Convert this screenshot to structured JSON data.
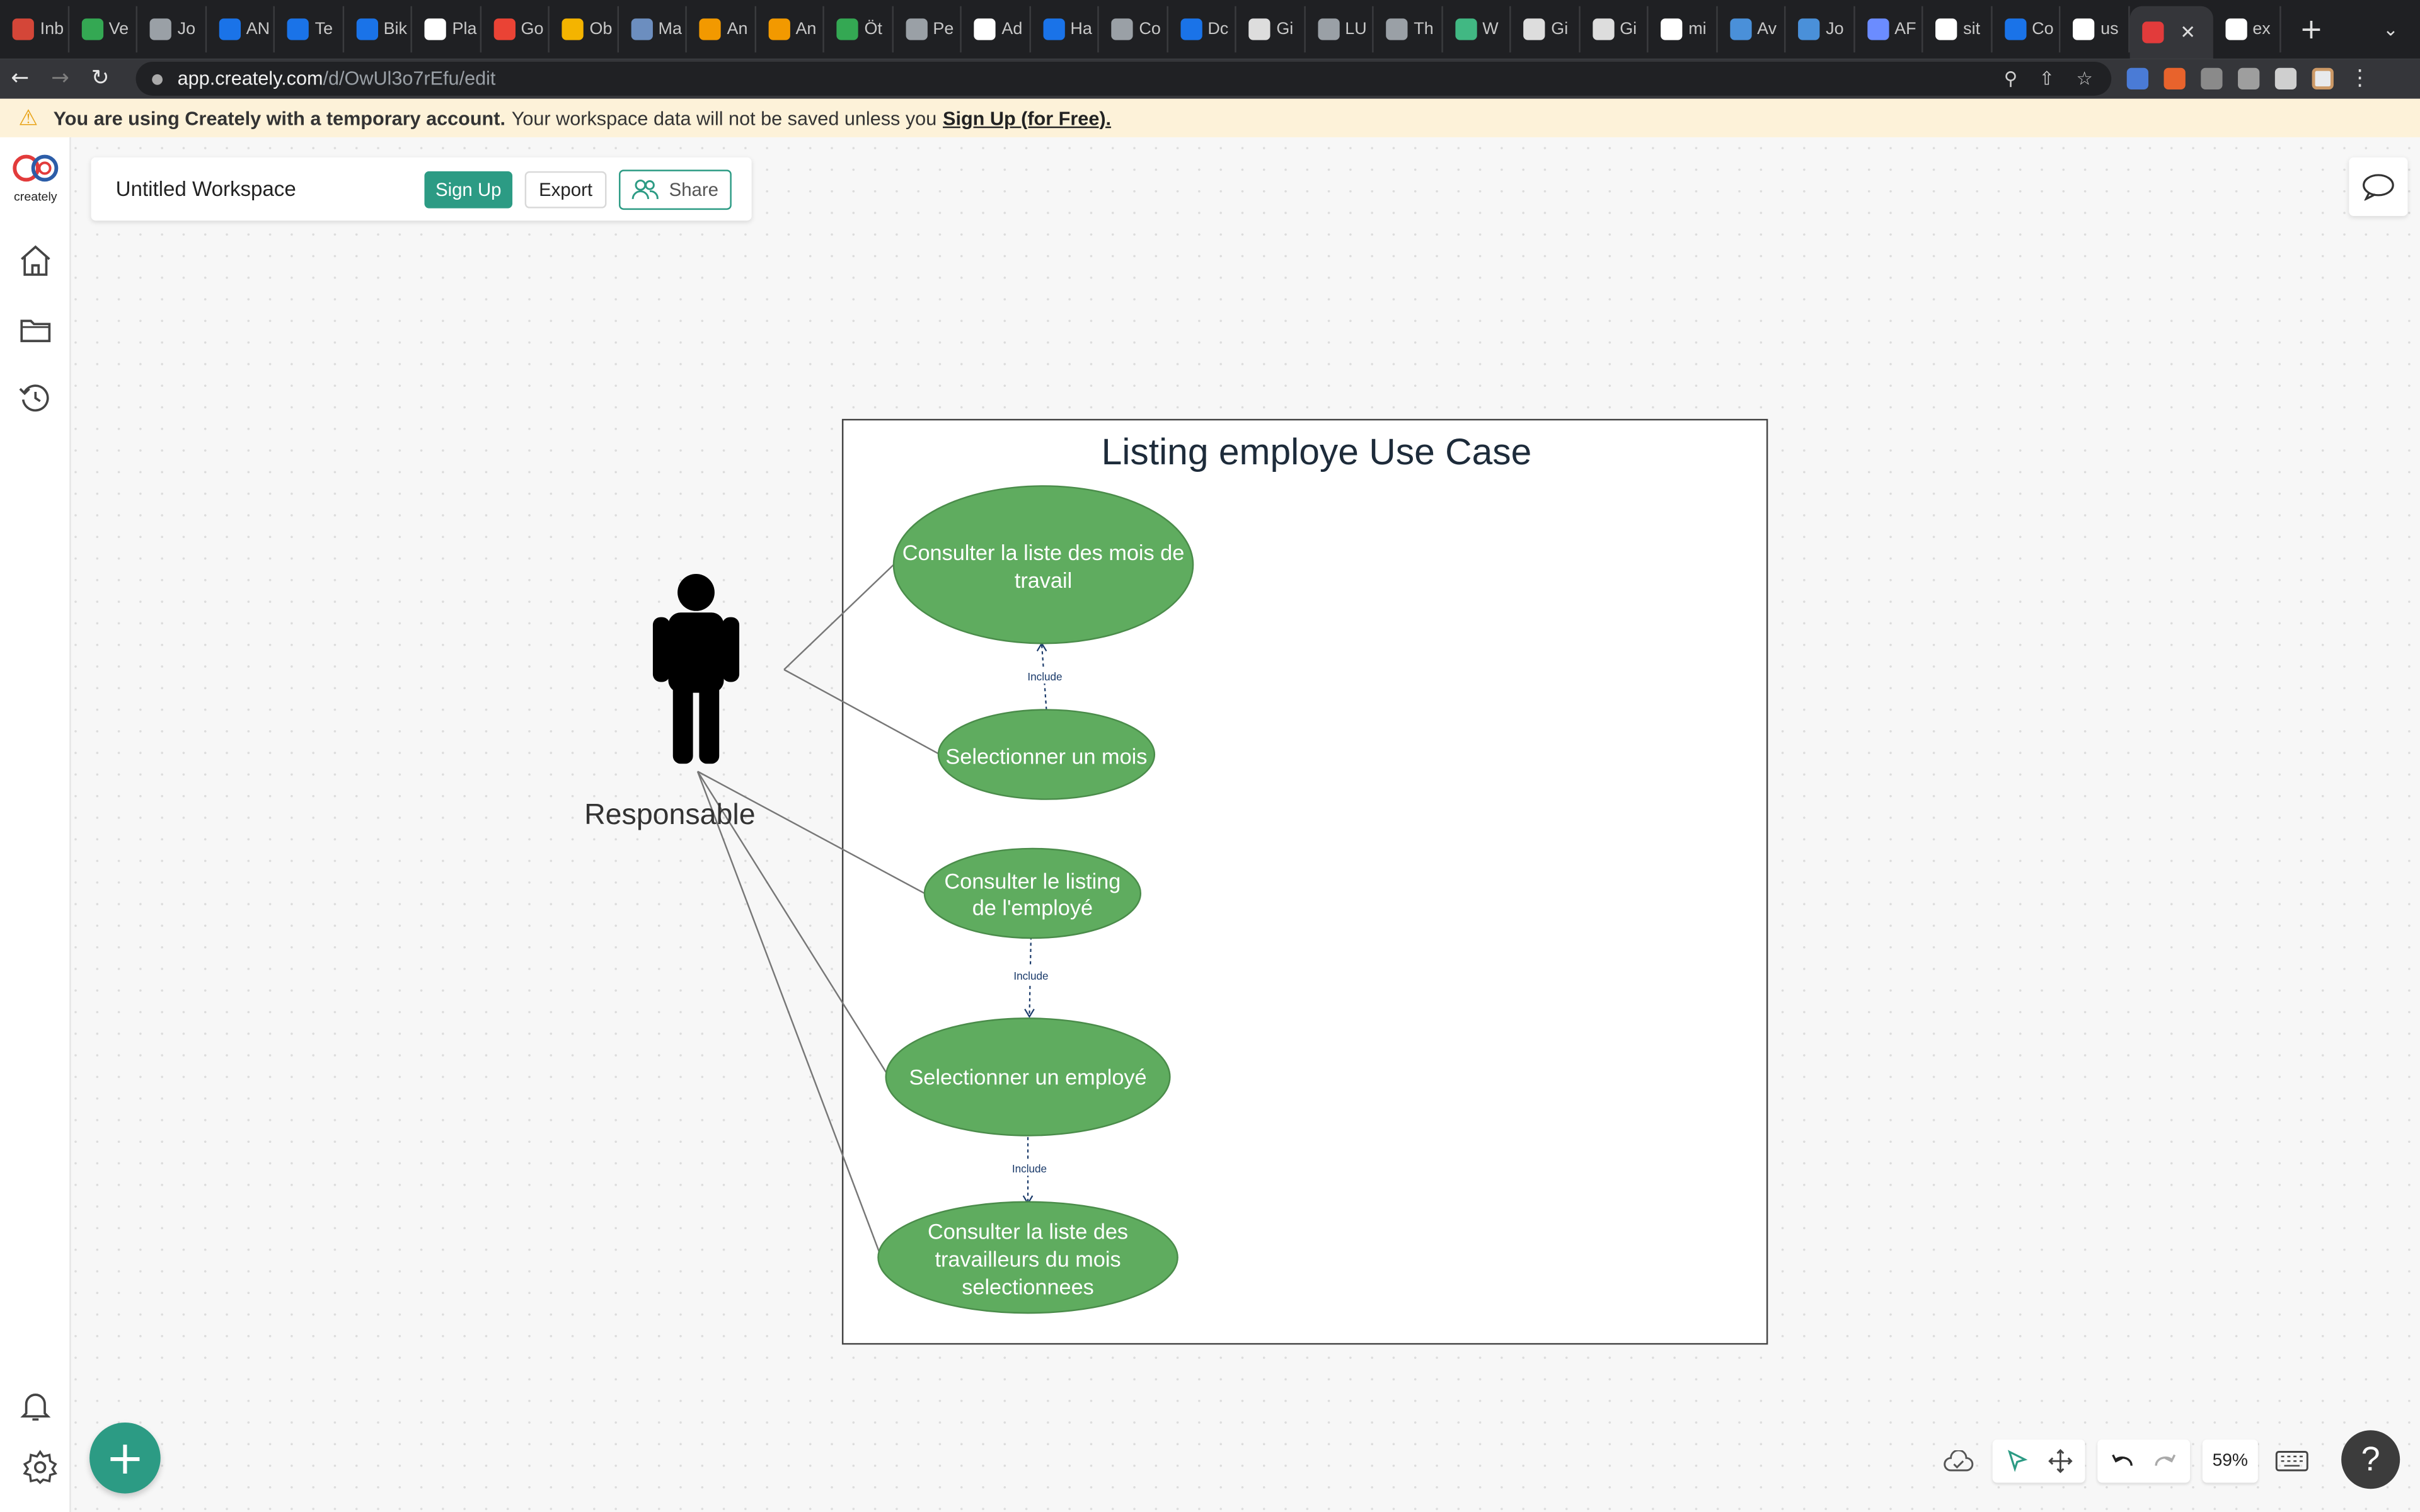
{
  "browser": {
    "tabs": [
      "Inb",
      "Ve",
      "Jo",
      "AN",
      "Te",
      "Bik",
      "Pla",
      "Go",
      "Ob",
      "Ma",
      "An",
      "An",
      "Öt",
      "Pe",
      "Ad",
      "Ha",
      "Co",
      "Dc",
      "Gi",
      "LU",
      "Th",
      "W",
      "Gi",
      "Gi",
      "mi",
      "Av",
      "Jo",
      "AF",
      "sit",
      "Co",
      "us",
      "",
      "ex"
    ],
    "url_host": "app.creately.com",
    "url_path": "/d/OwUl3o7rEfu/edit"
  },
  "banner": {
    "bold": "You are using Creately with a temporary account.",
    "text": "Your workspace data will not be saved unless you",
    "link": "Sign Up (for Free)."
  },
  "sidebar": {
    "logo_text": "creately"
  },
  "workspace": {
    "title": "Untitled Workspace",
    "signup_label": "Sign Up",
    "export_label": "Export",
    "share_label": "Share"
  },
  "diagram": {
    "title": "Listing employe Use Case",
    "actor_label": "Responsable",
    "use_cases": {
      "uc1_line1": "Consulter la liste des mois de",
      "uc1_line2": "travail",
      "uc2": "Selectionner un mois",
      "uc3_line1": "Consulter le listing",
      "uc3_line2": "de l'employé",
      "uc4": "Selectionner un employé",
      "uc5_line1": "Consulter la liste des",
      "uc5_line2": "travailleurs du mois",
      "uc5_line3": "selectionnees"
    },
    "include_label": "Include",
    "fill_color": "#5fac5f"
  },
  "bottom": {
    "zoom": "59%",
    "help": "?"
  }
}
